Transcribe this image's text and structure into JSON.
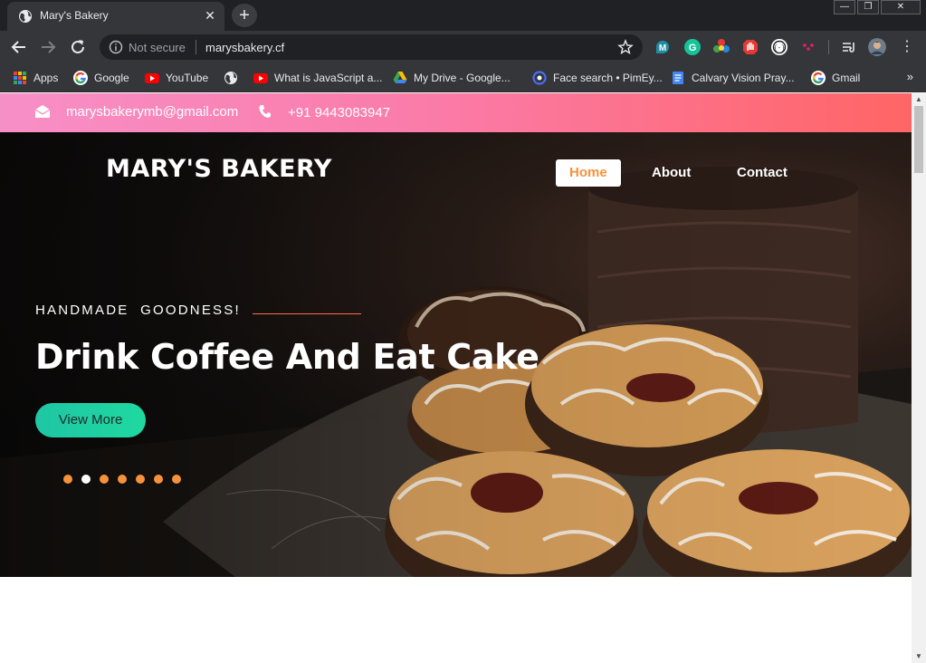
{
  "browser": {
    "tab_title": "Mary's Bakery",
    "security": "Not secure",
    "url": "marysbakery.cf",
    "bookmarks": [
      {
        "label": "Apps",
        "icon": "apps-grid-icon"
      },
      {
        "label": "Google",
        "icon": "google-icon"
      },
      {
        "label": "YouTube",
        "icon": "youtube-icon"
      },
      {
        "label": "",
        "icon": "globe-icon"
      },
      {
        "label": "What is JavaScript a...",
        "icon": "youtube-icon"
      },
      {
        "label": "My Drive - Google...",
        "icon": "google-drive-icon"
      },
      {
        "label": "Face search • PimEy...",
        "icon": "pimeyes-icon"
      },
      {
        "label": "Calvary Vision Pray...",
        "icon": "document-icon"
      },
      {
        "label": "Gmail",
        "icon": "google-icon"
      }
    ],
    "extensions": [
      "m-extension-icon",
      "grammarly-icon",
      "color-picker-icon",
      "adblock-hand-icon",
      "code-extension-icon",
      "dots-extension-icon",
      "media-controls-icon",
      "profile-avatar"
    ]
  },
  "site": {
    "email": "marysbakerymb@gmail.com",
    "phone": "+91 9443083947",
    "brand": "MARY'S BAKERY",
    "nav": [
      "Home",
      "About",
      "Contact"
    ],
    "active_nav": "Home",
    "eyebrow": "HANDMADE  GOODNESS!",
    "headline": "Drink Coffee And Eat Cake",
    "cta": "View More",
    "slides_count": 7,
    "active_slide_index": 1
  },
  "colors": {
    "topbar_gradient": [
      "#f78fc7",
      "#ff6565"
    ],
    "accent_orange": "#f7923c",
    "cta_teal": "#1fc6a4"
  }
}
